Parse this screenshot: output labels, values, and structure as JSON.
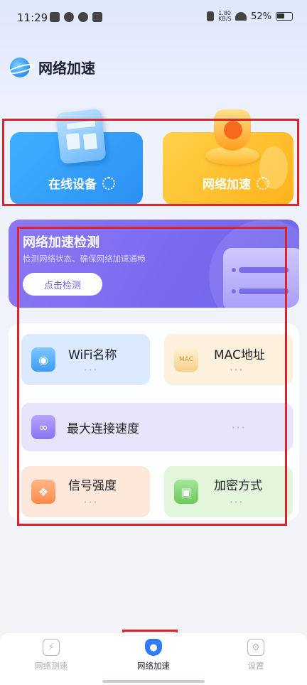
{
  "status_bar": {
    "time": "11:29",
    "network_speed_top": "1.80",
    "network_speed_unit": "KB/S",
    "battery": "52%"
  },
  "header": {
    "title": "网络加速",
    "logo_icon": "planet-logo-icon"
  },
  "top_cards": {
    "devices": {
      "label": "在线设备",
      "color": "#2d8ff2"
    },
    "accelerate": {
      "label": "网络加速",
      "color": "#ffb21b"
    }
  },
  "detect": {
    "title": "网络加速检测",
    "subtitle": "检测网络状态、确保网络加速通畅",
    "button": "点击检测",
    "color": "#7a6af0"
  },
  "info": {
    "wifi": {
      "label": "WiFi名称",
      "value": "···",
      "icon": "user-card-icon"
    },
    "mac": {
      "label": "MAC地址",
      "value": "···",
      "icon": "mac-chip-icon"
    },
    "speed": {
      "label": "最大连接速度",
      "value": "···",
      "icon": "link-icon"
    },
    "signal": {
      "label": "信号强度",
      "value": "···",
      "icon": "rss-signal-icon"
    },
    "encrypt": {
      "label": "加密方式",
      "value": "···",
      "icon": "lock-icon"
    }
  },
  "nav": {
    "test": {
      "label": "网络测速",
      "icon": "lightning-icon"
    },
    "accelerate": {
      "label": "网络加速",
      "icon": "shield-icon"
    },
    "settings": {
      "label": "设置",
      "icon": "gear-icon"
    }
  },
  "highlight_color": "#e0232b"
}
